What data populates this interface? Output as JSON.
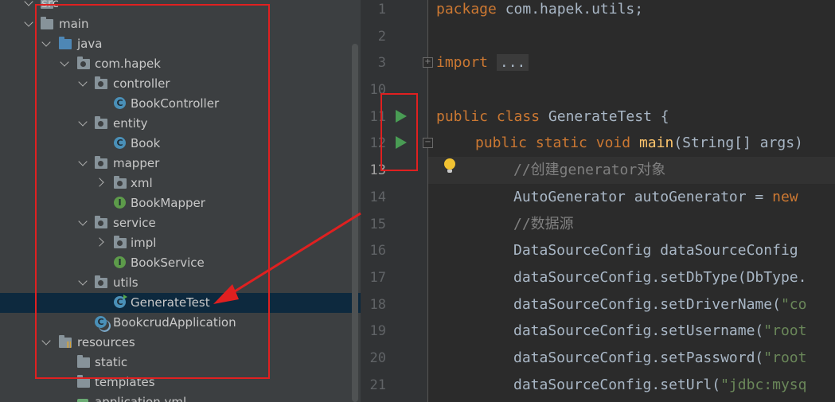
{
  "tree": {
    "items": [
      {
        "id": "src",
        "label": "src",
        "icon": "folder-icon"
      },
      {
        "id": "main",
        "label": "main",
        "icon": "folder-icon"
      },
      {
        "id": "java",
        "label": "java",
        "icon": "source-folder-icon"
      },
      {
        "id": "com_hapek",
        "label": "com.hapek",
        "icon": "package-icon"
      },
      {
        "id": "controller",
        "label": "controller",
        "icon": "package-icon"
      },
      {
        "id": "BookController",
        "label": "BookController",
        "icon": "class-icon"
      },
      {
        "id": "entity",
        "label": "entity",
        "icon": "package-icon"
      },
      {
        "id": "Book",
        "label": "Book",
        "icon": "class-icon"
      },
      {
        "id": "mapper",
        "label": "mapper",
        "icon": "package-icon"
      },
      {
        "id": "xml",
        "label": "xml",
        "icon": "package-icon"
      },
      {
        "id": "BookMapper",
        "label": "BookMapper",
        "icon": "interface-icon"
      },
      {
        "id": "service",
        "label": "service",
        "icon": "package-icon"
      },
      {
        "id": "impl",
        "label": "impl",
        "icon": "package-icon"
      },
      {
        "id": "BookService",
        "label": "BookService",
        "icon": "interface-icon"
      },
      {
        "id": "utils",
        "label": "utils",
        "icon": "package-icon"
      },
      {
        "id": "GenerateTest",
        "label": "GenerateTest",
        "icon": "runnable-class-icon",
        "selected": true
      },
      {
        "id": "BookcrudApplication",
        "label": "BookcrudApplication",
        "icon": "spring-boot-app-icon"
      },
      {
        "id": "resources",
        "label": "resources",
        "icon": "resources-folder-icon"
      },
      {
        "id": "static",
        "label": "static",
        "icon": "folder-icon"
      },
      {
        "id": "templates",
        "label": "templates",
        "icon": "folder-icon"
      },
      {
        "id": "application_yml",
        "label": "application.yml",
        "icon": "yaml-file-icon"
      }
    ]
  },
  "editor": {
    "current_line": "13",
    "lines": [
      {
        "num": "1"
      },
      {
        "num": "2"
      },
      {
        "num": "3"
      },
      {
        "num": "10"
      },
      {
        "num": "11"
      },
      {
        "num": "12"
      },
      {
        "num": "13"
      },
      {
        "num": "14"
      },
      {
        "num": "15"
      },
      {
        "num": "16"
      },
      {
        "num": "17"
      },
      {
        "num": "18"
      },
      {
        "num": "19"
      },
      {
        "num": "20"
      },
      {
        "num": "21"
      }
    ],
    "code": {
      "l1_kw": "package",
      "l1_rest": " com.hapek.utils;",
      "l3_kw": "import",
      "l3_dots": "...",
      "l11_kw1": "public",
      "l11_kw2": "class",
      "l11_rest": " GenerateTest {",
      "l12_kw1": "public",
      "l12_kw2": "static",
      "l12_kw3": "void",
      "l12_fn": "main",
      "l12_rest": "(String[] args)",
      "l13_comment": "//创建generator对象",
      "l14_rest": "AutoGenerator autoGenerator = ",
      "l14_kw": "new",
      "l15_comment": "//数据源",
      "l16_rest": "DataSourceConfig dataSourceConfig",
      "l17_rest": "dataSourceConfig.setDbType(DbType.",
      "l18_rest": "dataSourceConfig.setDriverName(",
      "l18_str": "\"co",
      "l19_rest": "dataSourceConfig.setUsername(",
      "l19_str": "\"root",
      "l20_rest": "dataSourceConfig.setPassword(",
      "l20_str": "\"root",
      "l21_rest": "dataSourceConfig.setUrl(",
      "l21_str": "\"jdbc:mysq"
    }
  },
  "colors": {
    "annotation_red": "#e02020",
    "run_green": "#499c54",
    "selection": "#0d293e"
  }
}
